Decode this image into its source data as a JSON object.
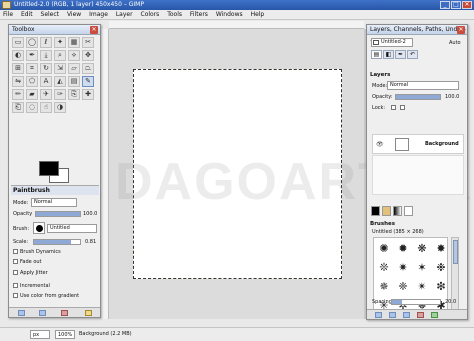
{
  "window": {
    "title": "Untitled-2.0 (RGB, 1 layer) 450x450 – GIMP",
    "minimize": "_",
    "maximize": "□",
    "close": "✕"
  },
  "menu": [
    "File",
    "Edit",
    "Select",
    "View",
    "Image",
    "Layer",
    "Colors",
    "Tools",
    "Filters",
    "Windows",
    "Help"
  ],
  "watermark": "DAGOARTOK",
  "toolbox": {
    "title": "Toolbox",
    "close": "✕",
    "tools": [
      {
        "icon": "rect-select-icon",
        "glyph": "▭"
      },
      {
        "icon": "ellipse-select-icon",
        "glyph": "◯"
      },
      {
        "icon": "free-select-icon",
        "glyph": "ℓ"
      },
      {
        "icon": "fuzzy-select-icon",
        "glyph": "✦"
      },
      {
        "icon": "color-select-icon",
        "glyph": "▦"
      },
      {
        "icon": "scissors-icon",
        "glyph": "✂"
      },
      {
        "icon": "foreground-select-icon",
        "glyph": "◐"
      },
      {
        "icon": "paths-icon",
        "glyph": "✒"
      },
      {
        "icon": "color-picker-icon",
        "glyph": "⤓"
      },
      {
        "icon": "zoom-icon",
        "glyph": "⌕"
      },
      {
        "icon": "measure-icon",
        "glyph": "⟡"
      },
      {
        "icon": "move-icon",
        "glyph": "✥"
      },
      {
        "icon": "align-icon",
        "glyph": "⊞"
      },
      {
        "icon": "crop-icon",
        "glyph": "⌗"
      },
      {
        "icon": "rotate-icon",
        "glyph": "↻"
      },
      {
        "icon": "scale-icon",
        "glyph": "⇲"
      },
      {
        "icon": "shear-icon",
        "glyph": "▱"
      },
      {
        "icon": "perspective-icon",
        "glyph": "⏢"
      },
      {
        "icon": "flip-icon",
        "glyph": "⇋"
      },
      {
        "icon": "cage-icon",
        "glyph": "⬠"
      },
      {
        "icon": "text-icon",
        "glyph": "A"
      },
      {
        "icon": "bucket-fill-icon",
        "glyph": "◭"
      },
      {
        "icon": "blend-icon",
        "glyph": "▤"
      },
      {
        "icon": "paintbrush-icon",
        "glyph": "✎"
      },
      {
        "icon": "pencil-icon",
        "glyph": "✏"
      },
      {
        "icon": "eraser-icon",
        "glyph": "▰"
      },
      {
        "icon": "airbrush-icon",
        "glyph": "✈"
      },
      {
        "icon": "ink-icon",
        "glyph": "✑"
      },
      {
        "icon": "clone-icon",
        "glyph": "⎘"
      },
      {
        "icon": "heal-icon",
        "glyph": "✚"
      },
      {
        "icon": "perspective-clone-icon",
        "glyph": "⎗"
      },
      {
        "icon": "blur-icon",
        "glyph": "◌"
      },
      {
        "icon": "smudge-icon",
        "glyph": "☝"
      },
      {
        "icon": "dodge-burn-icon",
        "glyph": "◑"
      }
    ],
    "active_index": 23,
    "options_title": "Paintbrush",
    "mode_label": "Mode:",
    "mode_value": "Normal",
    "opacity_label": "Opacity",
    "opacity_value": "100.0",
    "opacity_fraction": 1.0,
    "brush_label": "Brush:",
    "brush_value": "Untitled",
    "scale_label": "Scale:",
    "scale_value": "0.81",
    "scale_fraction": 0.81,
    "brush_dynamics": "Brush Dynamics",
    "fade_out": "Fade out",
    "apply_jitter": "Apply Jitter",
    "incremental": "Incremental",
    "use_gradient": "Use color from gradient"
  },
  "dock": {
    "title": "Layers, Channels, Paths, Undo – ...",
    "close": "✕",
    "image_combo": "Untitled-2",
    "auto_label": "Auto",
    "layers_title": "Layers",
    "mode_label": "Mode:",
    "mode_value": "Normal",
    "opacity_label": "Opacity:",
    "opacity_value": "100.0",
    "opacity_fraction": 1.0,
    "lock_label": "Lock:",
    "layer_name": "Background",
    "brushes_title": "Brushes",
    "brush_info": "Untitled (385 × 268)",
    "spacing_label": "Spacing",
    "spacing_value": "20.0",
    "spacing_fraction": 0.2
  },
  "status": {
    "unit": "px",
    "zoom": "100%",
    "info": "Background (2.2 MB)"
  }
}
